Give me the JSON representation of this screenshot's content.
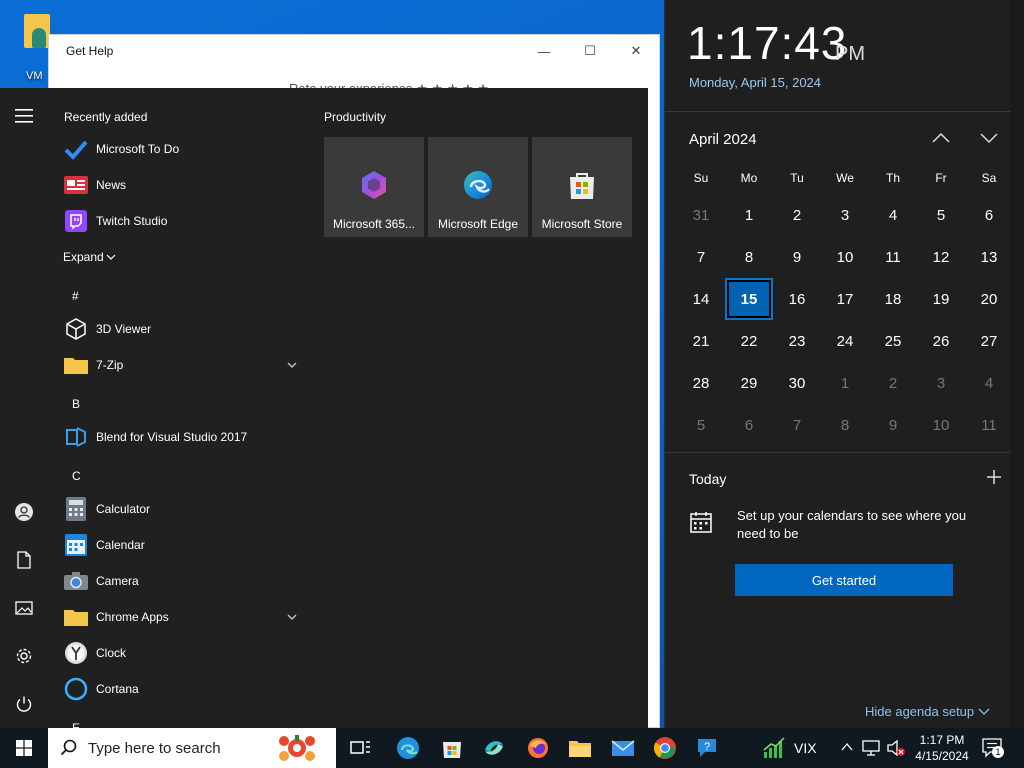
{
  "desktop": {
    "icon_label": "VM"
  },
  "get_help_window": {
    "title": "Get Help",
    "rate_text": "Rate your experience ★ ★ ★ ★ ★"
  },
  "start_menu": {
    "recently_added_label": "Recently added",
    "recent_apps": [
      "Microsoft To Do",
      "News",
      "Twitch Studio"
    ],
    "expand_label": "Expand",
    "section_hash": "#",
    "apps_hash": [
      "3D Viewer",
      "7-Zip"
    ],
    "section_b": "B",
    "apps_b": [
      "Blend for Visual Studio 2017"
    ],
    "section_c": "C",
    "apps_c": [
      "Calculator",
      "Calendar",
      "Camera",
      "Chrome Apps",
      "Clock",
      "Cortana"
    ],
    "section_e": "E",
    "tiles_group": "Productivity",
    "tiles": [
      "Microsoft 365...",
      "Microsoft Edge",
      "Microsoft Store"
    ]
  },
  "clock_flyout": {
    "time": "1:17:43",
    "ampm": "PM",
    "date_long": "Monday, April 15, 2024",
    "month_label": "April 2024",
    "weekdays": [
      "Su",
      "Mo",
      "Tu",
      "We",
      "Th",
      "Fr",
      "Sa"
    ],
    "weeks": [
      [
        "31",
        "1",
        "2",
        "3",
        "4",
        "5",
        "6"
      ],
      [
        "7",
        "8",
        "9",
        "10",
        "11",
        "12",
        "13"
      ],
      [
        "14",
        "15",
        "16",
        "17",
        "18",
        "19",
        "20"
      ],
      [
        "21",
        "22",
        "23",
        "24",
        "25",
        "26",
        "27"
      ],
      [
        "28",
        "29",
        "30",
        "1",
        "2",
        "3",
        "4"
      ],
      [
        "5",
        "6",
        "7",
        "8",
        "9",
        "10",
        "11"
      ]
    ],
    "selected_day": "15",
    "today_label": "Today",
    "setup_message": "Set up your calendars to see where you need to be",
    "get_started_label": "Get started",
    "hide_agenda_label": "Hide agenda setup"
  },
  "taskbar": {
    "search_placeholder": "Type here to search",
    "stock_ticker": "VIX",
    "clock_time": "1:17 PM",
    "clock_date": "4/15/2024",
    "notification_count": "1"
  },
  "colors": {
    "accent": "#0078d7",
    "start_bg": "#202020",
    "flyout_bg": "#1f1f1f",
    "taskbar_bg": "#101820"
  }
}
